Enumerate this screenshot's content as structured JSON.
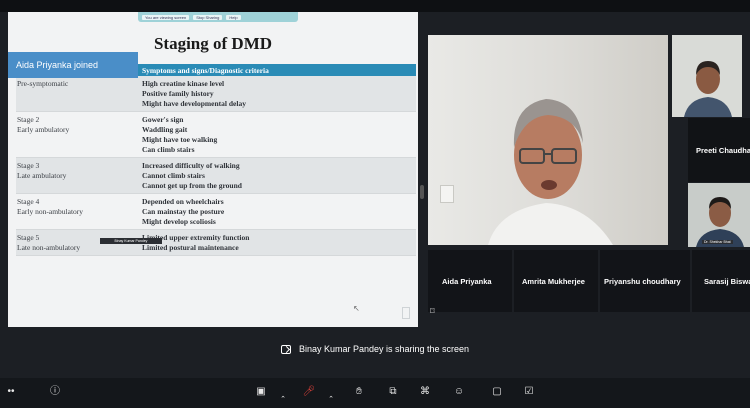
{
  "slide": {
    "share_controls": [
      "You are viewing screen",
      "Stop Sharing",
      "Help"
    ],
    "title": "Staging of DMD",
    "header": "Symptoms and signs/Diagnostic criteria",
    "rows": [
      {
        "stage": "Pre-symptomatic",
        "stage_sub": "",
        "criteria": [
          "High creatine kinase level",
          "Positive family history",
          "Might have developmental delay"
        ]
      },
      {
        "stage": "Stage 2",
        "stage_sub": "Early ambulatory",
        "criteria": [
          "Gower's sign",
          "Waddling gait",
          "Might have toe walking",
          "Can climb stairs"
        ]
      },
      {
        "stage": "Stage 3",
        "stage_sub": "Late ambulatory",
        "criteria": [
          "Increased difficulty of walking",
          "Cannot climb stairs",
          "Cannot get up from the ground"
        ]
      },
      {
        "stage": "Stage 4",
        "stage_sub": "Early non-ambulatory",
        "criteria": [
          "Depended on wheelchairs",
          "Can mainstay the posture",
          "Might develop scoliosis"
        ]
      },
      {
        "stage": "Stage 5",
        "stage_sub": "Late non-ambulatory",
        "criteria": [
          "Limited upper extremity function",
          "Limited postural maintenance"
        ]
      }
    ]
  },
  "toast": "Aida Priyanka joined",
  "main_speaker_label": "Binay Kumar Pandey",
  "participants": {
    "top_right_name": "Preeti Chaudhary",
    "right_middle_name": "Dr. Shekhar Bhat",
    "row": [
      "Aida Priyanka",
      "Amrita Mukherjee",
      "Priyanshu choudhary",
      "Sarasij Biswas"
    ]
  },
  "share_notice": "Binay Kumar Pandey is sharing the screen",
  "colors": {
    "table_header": "#2a8bb6",
    "toast": "#4a8ec8",
    "mute_red": "#e0413a"
  },
  "toolbar_icons": [
    "more-icon",
    "info-icon",
    "camera-icon",
    "chevron-up-icon",
    "microphone-muted-icon",
    "chevron-up-icon",
    "raise-hand-icon",
    "present-icon",
    "layout-icon",
    "people-icon",
    "chat-icon",
    "activities-icon"
  ]
}
